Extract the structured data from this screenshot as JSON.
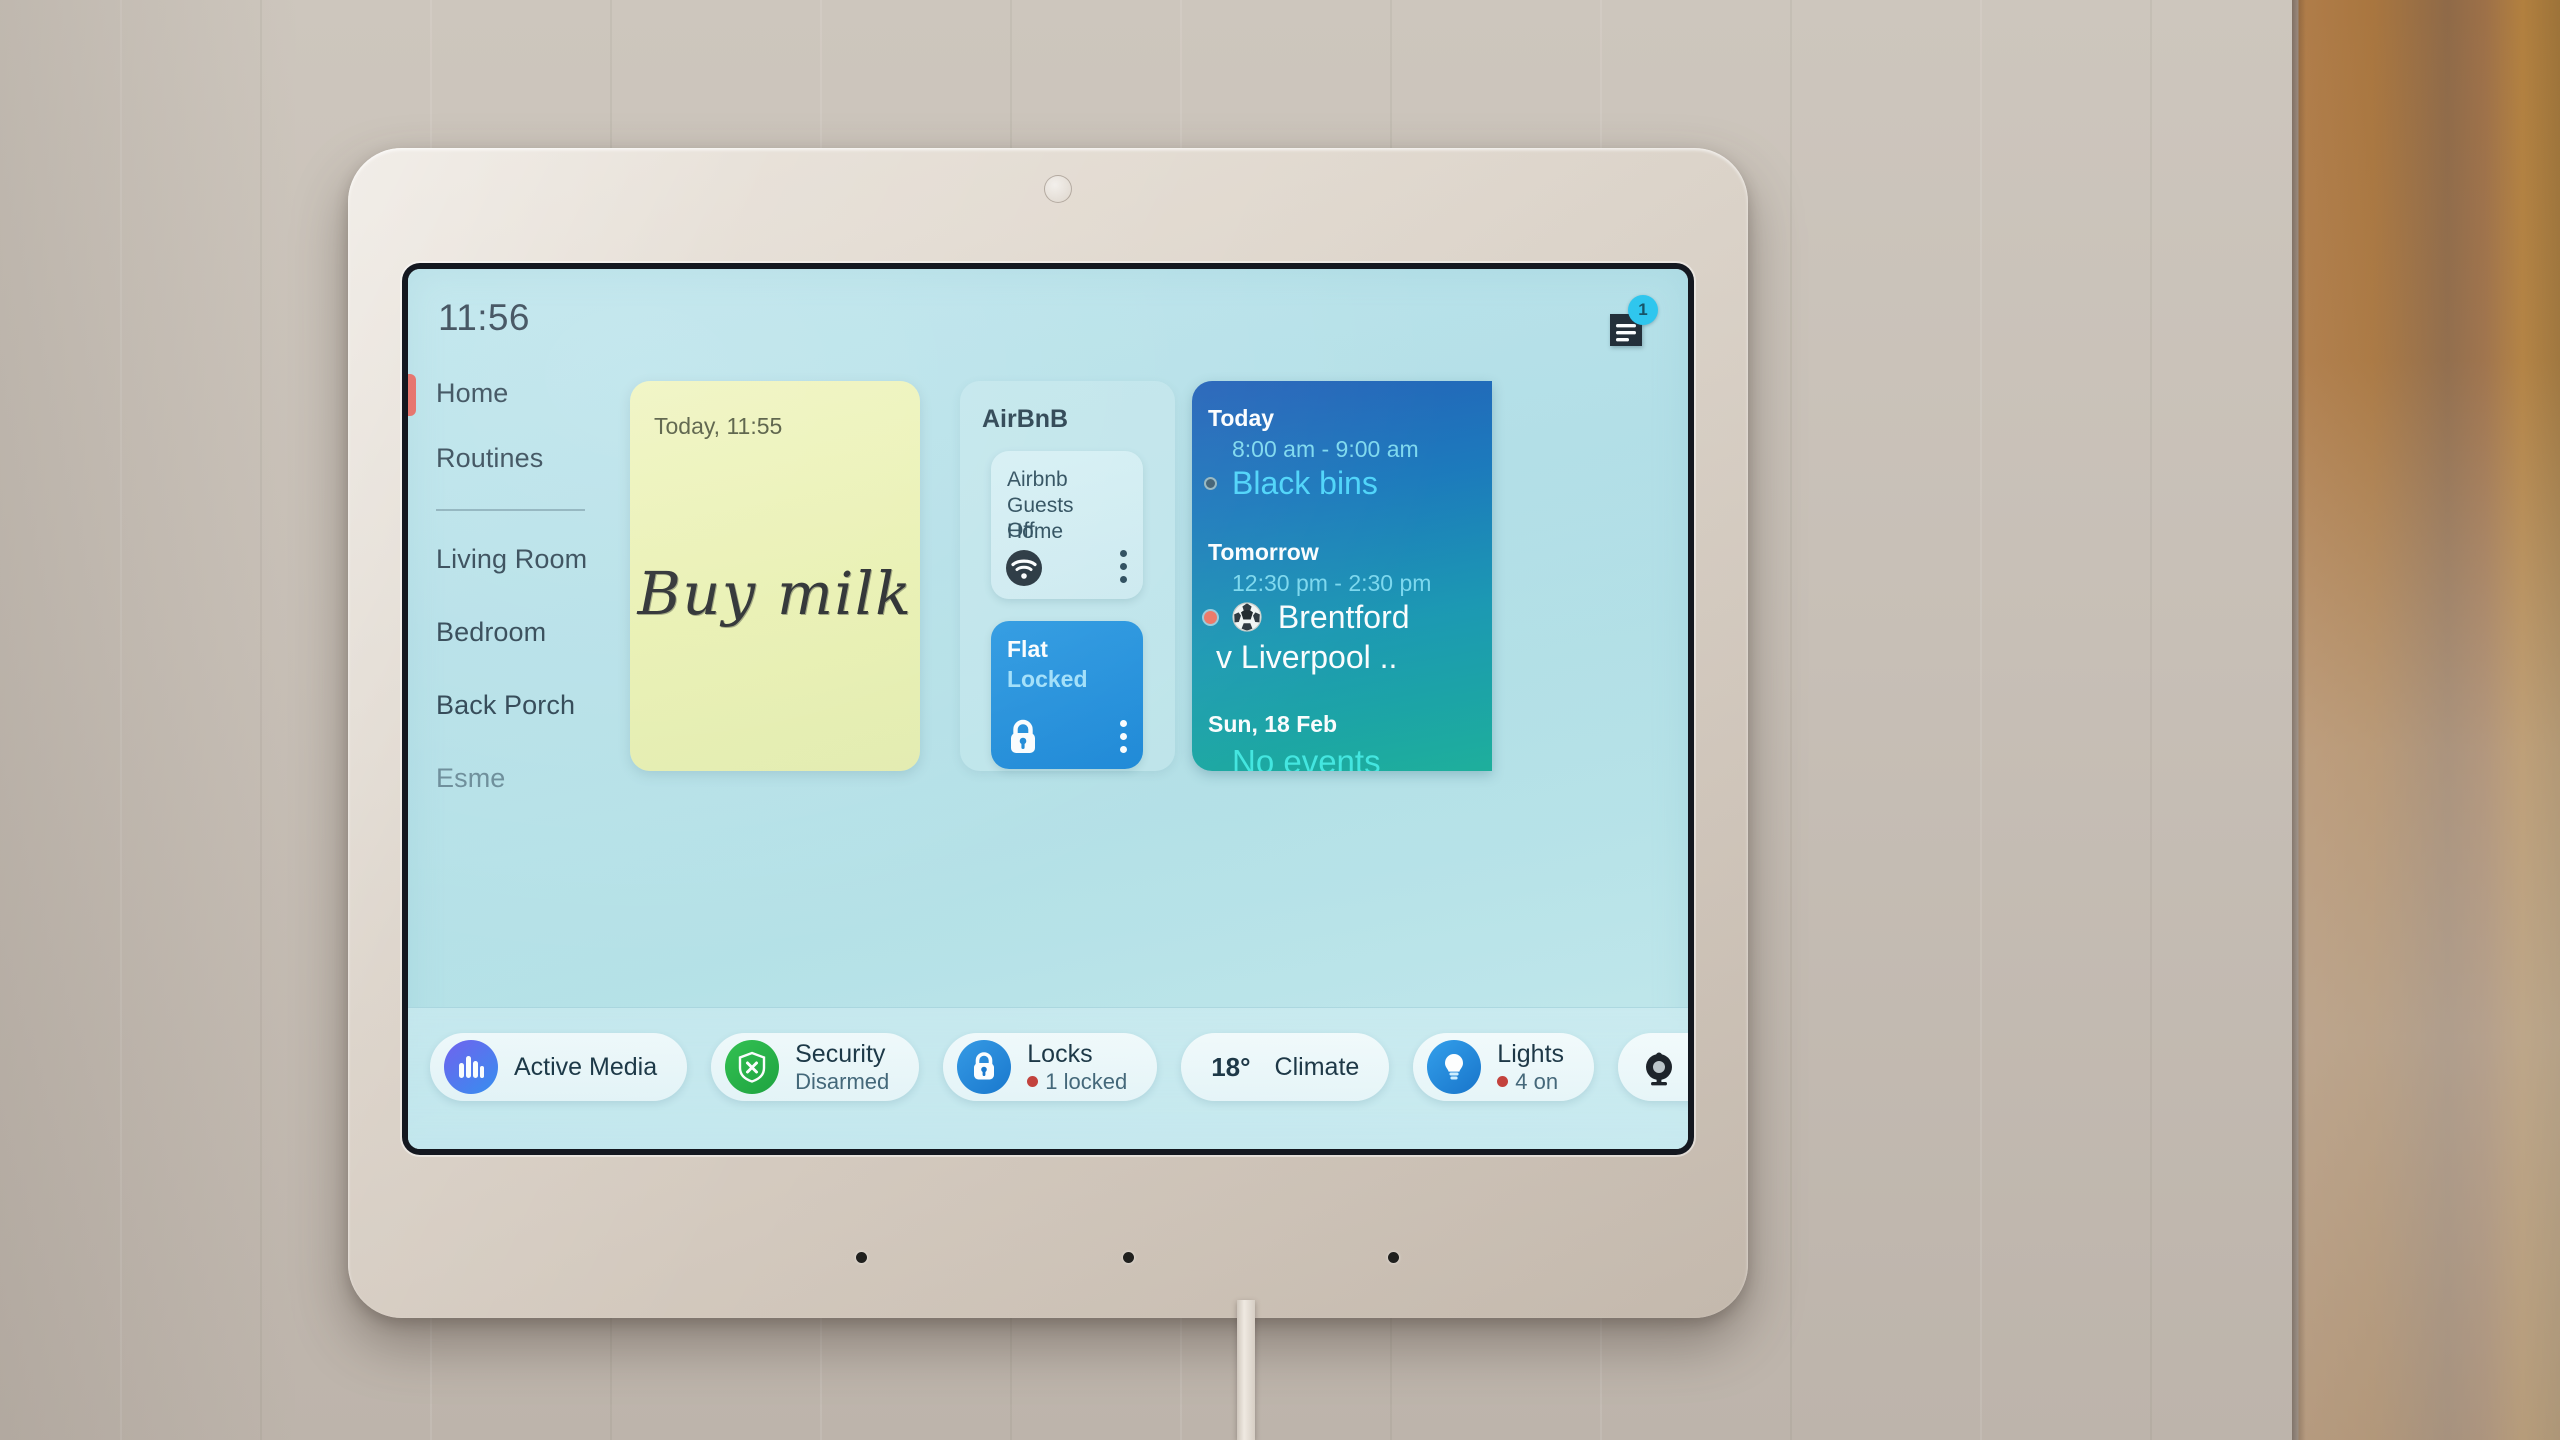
{
  "device": {
    "type": "wall-mounted smart home display",
    "camera_icon": "camera-lens"
  },
  "screen": {
    "status": {
      "clock": "11:56",
      "notification_icon": "notes-icon",
      "notification_count": "1"
    },
    "sidebar": {
      "active_item": "Home",
      "items": [
        {
          "label": "Home",
          "active": true
        },
        {
          "label": "Routines",
          "active": false
        }
      ],
      "rooms": [
        {
          "label": "Living Room"
        },
        {
          "label": "Bedroom"
        },
        {
          "label": "Back Porch"
        },
        {
          "label": "Esme"
        }
      ]
    },
    "note_card": {
      "timestamp": "Today, 11:55",
      "text": "Buy milk"
    },
    "airbnb_card": {
      "title": "AirBnB",
      "tiles": [
        {
          "name": "Airbnb Guests Home",
          "state": "Off",
          "icon": "wifi-icon",
          "menu_icon": "more-vertical-icon",
          "active": false
        },
        {
          "name": "Flat",
          "state": "Locked",
          "icon": "lock-closed-icon",
          "menu_icon": "more-vertical-icon",
          "active": true
        }
      ]
    },
    "calendar_card": {
      "blocks": [
        {
          "day": "Today",
          "time": "8:00 am - 9:00 am",
          "event": "Black bins",
          "dot": "hollow",
          "icon": ""
        },
        {
          "day": "Tomorrow",
          "time": "12:30 pm - 2:30 pm",
          "event": "Brentford",
          "event_line2": "v Liverpool ..",
          "dot": "red",
          "icon": "soccer-ball-icon"
        },
        {
          "day": "Sun, 18 Feb",
          "event": "No events"
        }
      ]
    },
    "bottom_bar": {
      "pills": [
        {
          "title": "Active Media",
          "sub": "",
          "icon": "equalizer-icon",
          "temp": ""
        },
        {
          "title": "Security",
          "sub": "Disarmed",
          "icon": "shield-x-icon",
          "temp": ""
        },
        {
          "title": "Locks",
          "sub": "1 locked",
          "icon": "lock-closed-icon",
          "temp": ""
        },
        {
          "title": "Climate",
          "sub": "",
          "icon": "",
          "temp": "18°"
        },
        {
          "title": "Lights",
          "sub": "4 on",
          "icon": "lightbulb-icon",
          "temp": ""
        },
        {
          "title": "",
          "sub": "",
          "icon": "camera-icon",
          "temp": ""
        }
      ]
    }
  },
  "colors": {
    "screen_bg": "#b6e2ea",
    "note_yellow": "#eef3b5",
    "tile_blue": "#1f93e0",
    "calendar_top": "#1657b4",
    "calendar_bottom": "#16ad98",
    "accent_red": "#e2584f",
    "badge_cyan": "#22c4ee",
    "security_green": "#22b23f"
  }
}
